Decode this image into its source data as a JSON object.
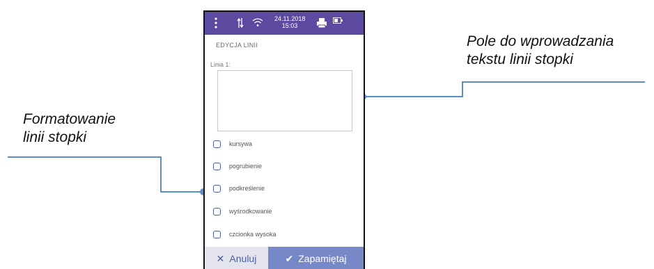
{
  "colors": {
    "statusbar": "#5b4a9f",
    "accent": "#4a5fa5",
    "save_button": "#7788c8",
    "cancel_button": "#e4e4ef",
    "callout_line": "#5b8dc6"
  },
  "callouts": {
    "left": {
      "line1": "Formatowanie",
      "line2": "linii stopki"
    },
    "right": {
      "line1": "Pole do wprowadzania",
      "line2": "tekstu linii stopki"
    }
  },
  "statusbar": {
    "date": "24.11.2018",
    "time": "15:03",
    "icons": [
      "menu-icon",
      "transfer-icon",
      "wifi-icon",
      "printer-icon",
      "battery-icon"
    ]
  },
  "screen": {
    "title": "EDYCJA LINII",
    "field_label": "Linia 1:",
    "text_value": "",
    "options": [
      {
        "label": "kursywa",
        "checked": false
      },
      {
        "label": "pogrubienie",
        "checked": false
      },
      {
        "label": "podkreślenie",
        "checked": false
      },
      {
        "label": "wyśrodkowanie",
        "checked": false
      },
      {
        "label": "czcionka wysoka",
        "checked": false
      }
    ]
  },
  "buttons": {
    "cancel": "Anuluj",
    "save": "Zapamiętaj",
    "cancel_icon": "close-icon",
    "save_icon": "checkmark-icon"
  }
}
